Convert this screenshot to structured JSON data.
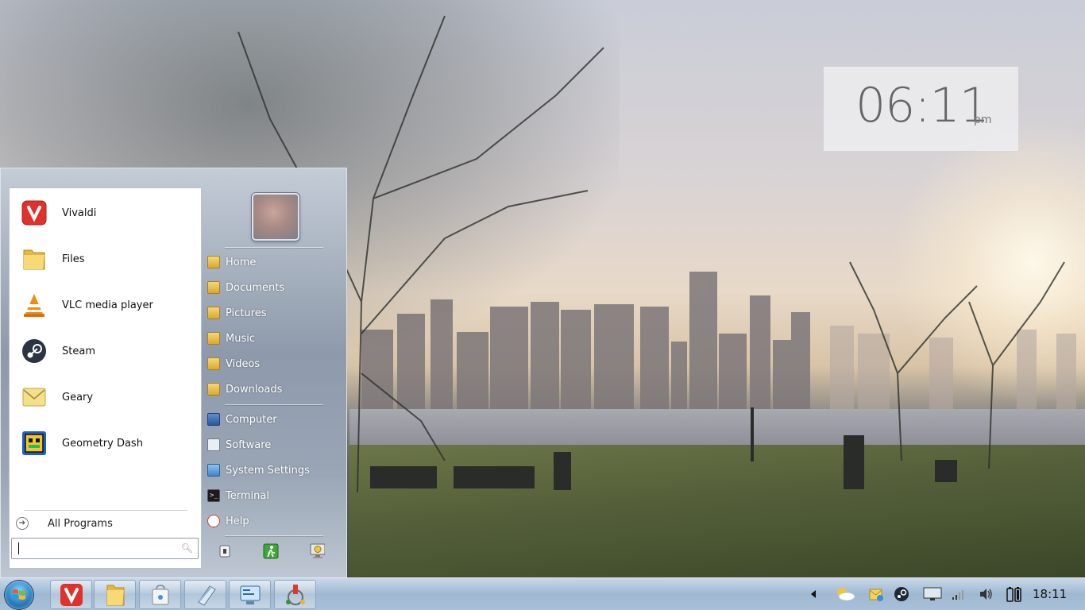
{
  "desktop": {
    "clock": {
      "time": "06:11",
      "ampm": "pm"
    }
  },
  "start_menu": {
    "programs": [
      {
        "label": "Vivaldi",
        "icon": "vivaldi-icon"
      },
      {
        "label": "Files",
        "icon": "folder-icon"
      },
      {
        "label": "VLC media player",
        "icon": "vlc-icon"
      },
      {
        "label": "Steam",
        "icon": "steam-icon"
      },
      {
        "label": "Geary",
        "icon": "mail-icon"
      },
      {
        "label": "Geometry Dash",
        "icon": "geometry-dash-icon"
      }
    ],
    "all_programs_label": "All Programs",
    "search": {
      "value": "",
      "placeholder": ""
    },
    "places": [
      {
        "label": "Home",
        "icon": "folder-icon"
      },
      {
        "label": "Documents",
        "icon": "folder-icon"
      },
      {
        "label": "Pictures",
        "icon": "folder-icon"
      },
      {
        "label": "Music",
        "icon": "folder-icon"
      },
      {
        "label": "Videos",
        "icon": "folder-icon"
      },
      {
        "label": "Downloads",
        "icon": "folder-icon"
      }
    ],
    "system": [
      {
        "label": "Computer",
        "icon": "computer-icon"
      },
      {
        "label": "Software",
        "icon": "software-icon"
      },
      {
        "label": "System Settings",
        "icon": "settings-icon"
      },
      {
        "label": "Terminal",
        "icon": "terminal-icon"
      },
      {
        "label": "Help",
        "icon": "help-icon"
      }
    ],
    "power_buttons": [
      "lock-icon",
      "logout-icon",
      "shutdown-icon"
    ]
  },
  "taskbar": {
    "pinned": [
      "vivaldi-icon",
      "folder-icon",
      "software-center-icon",
      "text-editor-icon",
      "settings-icon",
      "network-tool-icon"
    ],
    "tray_icons": [
      "show-hidden-icon",
      "weather-icon",
      "updates-icon",
      "steam-icon",
      "display-icon",
      "network-icon",
      "volume-icon",
      "battery-icon"
    ],
    "time": "18:11"
  },
  "colors": {
    "accent": "#1e6fb8",
    "menu_glass": "#9aa6b6",
    "taskbar": "#a8c0d8"
  }
}
